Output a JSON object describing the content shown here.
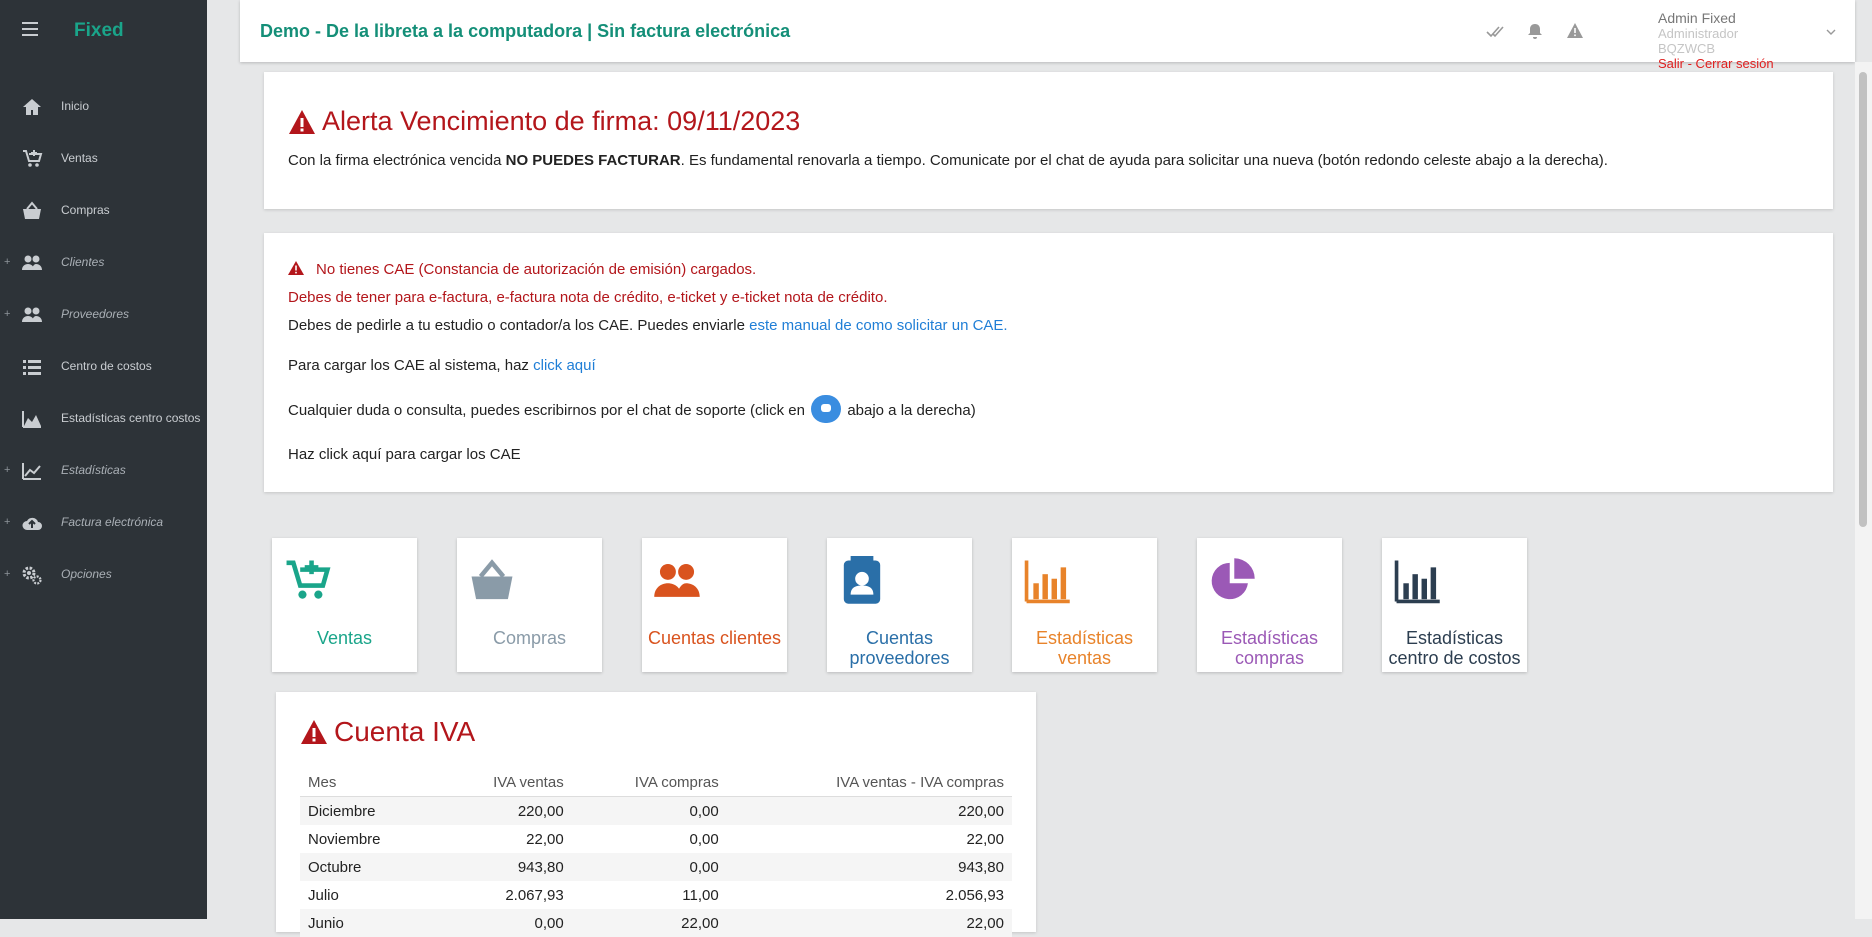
{
  "brand": "Fixed",
  "nav": [
    {
      "label": "Inicio",
      "icon": "home-icon",
      "expandable": false,
      "italic": false
    },
    {
      "label": "Ventas",
      "icon": "cart-plus-icon",
      "expandable": false,
      "italic": false
    },
    {
      "label": "Compras",
      "icon": "basket-icon",
      "expandable": false,
      "italic": false
    },
    {
      "label": "Clientes",
      "icon": "users-icon",
      "expandable": true,
      "italic": true
    },
    {
      "label": "Proveedores",
      "icon": "users-icon",
      "expandable": true,
      "italic": true
    },
    {
      "label": "Centro de costos",
      "icon": "list-icon",
      "expandable": false,
      "italic": false
    },
    {
      "label": "Estadísticas centro costos",
      "icon": "area-chart-icon",
      "expandable": false,
      "italic": false
    },
    {
      "label": "Estadísticas",
      "icon": "line-chart-icon",
      "expandable": true,
      "italic": true
    },
    {
      "label": "Factura electrónica",
      "icon": "cloud-upload-icon",
      "expandable": true,
      "italic": true
    },
    {
      "label": "Opciones",
      "icon": "gears-icon",
      "expandable": true,
      "italic": true
    }
  ],
  "topbar": {
    "title": "Demo - De la libreta a la computadora | Sin factura electrónica",
    "user_name": "Admin Fixed",
    "user_role": "Administrador",
    "user_code": "BQZWCB",
    "logout": "Salir - Cerrar sesión"
  },
  "alert_firma": {
    "title": "Alerta Vencimiento de firma: 09/11/2023",
    "msg_pre": "Con la firma electrónica vencida ",
    "msg_bold": "NO PUEDES FACTURAR",
    "msg_post": ". Es fundamental renovarla a tiempo. Comunicate por el chat de ayuda para solicitar una nueva (botón redondo celeste abajo a la derecha)."
  },
  "alert_cae": {
    "line1": "No tienes CAE (Constancia de autorización de emisión) cargados.",
    "line2": "Debes de tener para e-factura, e-factura nota de crédito, e-ticket y e-ticket nota de crédito.",
    "line3_pre": "Debes de pedirle a tu estudio o contador/a los CAE. Puedes enviarle ",
    "line3_link": "este manual de como solicitar un CAE.",
    "line4_pre": "Para cargar los CAE al sistema, haz ",
    "line4_link": "click aquí",
    "line5_pre": "Cualquier duda o consulta, puedes escribirnos por el chat de soporte (click en",
    "line5_post": "abajo a la derecha)",
    "line6": "Haz click aquí para cargar los CAE"
  },
  "tiles": [
    {
      "line1": "Ventas",
      "line2": "",
      "color": "#1aa58a",
      "icon": "cart-plus-icon"
    },
    {
      "line1": "Compras",
      "line2": "",
      "color": "#8a9ba8",
      "icon": "basket-icon"
    },
    {
      "line1": "Cuentas clientes",
      "line2": "",
      "color": "#d9531e",
      "icon": "users-icon"
    },
    {
      "line1": "Cuentas",
      "line2": "proveedores",
      "color": "#2a6fa8",
      "icon": "contact-card-icon"
    },
    {
      "line1": "Estadísticas",
      "line2": "ventas",
      "color": "#e8832a",
      "icon": "bar-chart-icon"
    },
    {
      "line1": "Estadísticas",
      "line2": "compras",
      "color": "#9b59b6",
      "icon": "pie-chart-icon"
    },
    {
      "line1": "Estadísticas",
      "line2": "centro de costos",
      "color": "#2c3e50",
      "icon": "bar-chart-icon"
    }
  ],
  "iva": {
    "title": "Cuenta IVA",
    "headers": [
      "Mes",
      "IVA ventas",
      "IVA compras",
      "IVA ventas - IVA compras"
    ],
    "rows": [
      [
        "Diciembre",
        "220,00",
        "0,00",
        "220,00"
      ],
      [
        "Noviembre",
        "22,00",
        "0,00",
        "22,00"
      ],
      [
        "Octubre",
        "943,80",
        "0,00",
        "943,80"
      ],
      [
        "Julio",
        "2.067,93",
        "11,00",
        "2.056,93"
      ],
      [
        "Junio",
        "0,00",
        "22,00",
        "22,00"
      ]
    ]
  }
}
